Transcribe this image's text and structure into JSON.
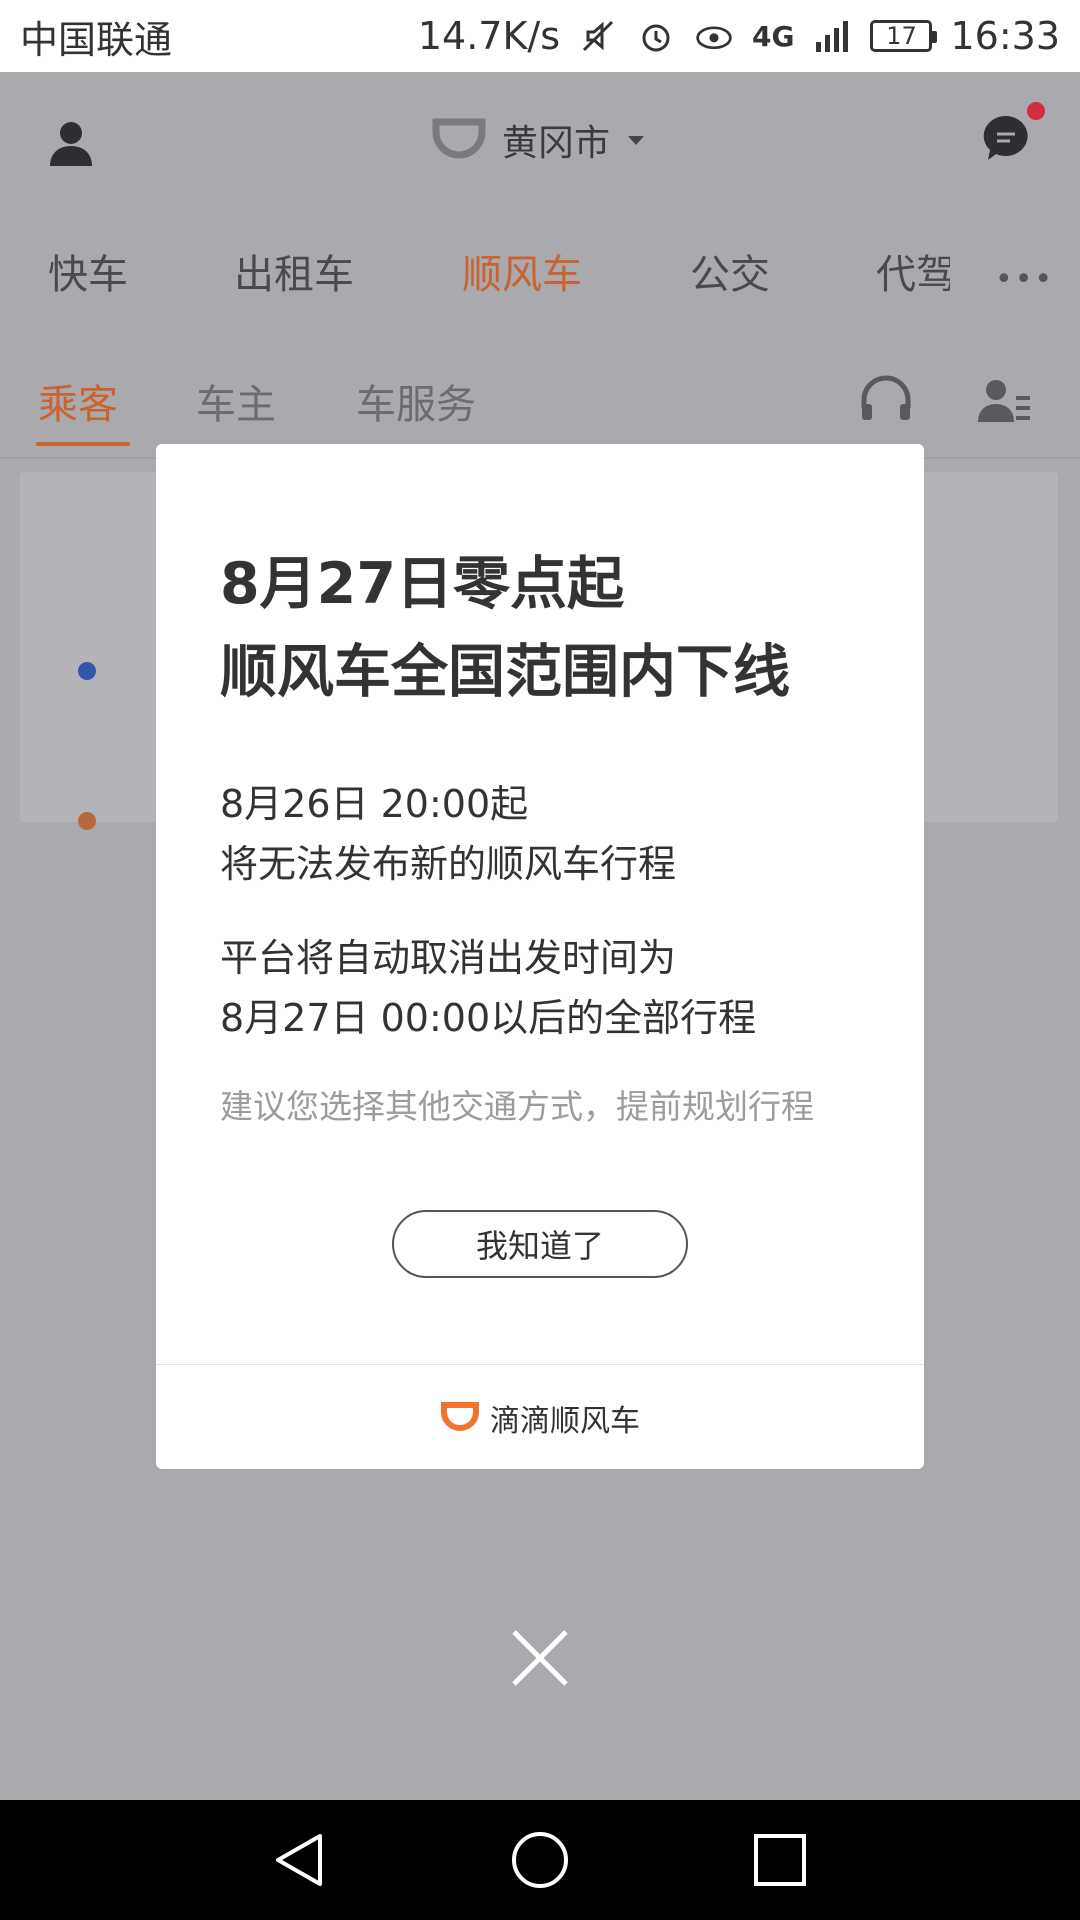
{
  "status_bar": {
    "carrier": "中国联通",
    "speed": "14.7K/s",
    "network": "4G",
    "battery": "17",
    "time": "16:33"
  },
  "header": {
    "city": "黄冈市"
  },
  "tabs": [
    {
      "label": "快车"
    },
    {
      "label": "出租车"
    },
    {
      "label": "顺风车",
      "active": true
    },
    {
      "label": "公交"
    },
    {
      "label": "代驾"
    }
  ],
  "subtabs": [
    {
      "label": "乘客",
      "active": true
    },
    {
      "label": "车主"
    },
    {
      "label": "车服务"
    }
  ],
  "modal": {
    "title_line1": "8月27日零点起",
    "title_line2": "顺风车全国范围内下线",
    "p1_line1": "8月26日 20:00起",
    "p1_line2": "将无法发布新的顺风车行程",
    "p2_line1": "平台将自动取消出发时间为",
    "p2_line2": "8月27日 00:00以后的全部行程",
    "hint": "建议您选择其他交通方式，提前规划行程",
    "ack_button": "我知道了",
    "brand": "滴滴顺风车"
  },
  "colors": {
    "accent": "#c9632f",
    "overlay_bg": "#a9a9ae",
    "brand_orange": "#f0742e",
    "notification": "#d12f3f"
  },
  "icons": {
    "avatar": "person-icon",
    "message": "chat-bubble-icon",
    "service": "headset-icon",
    "profile_list": "user-list-icon",
    "close": "close-icon",
    "nav_back": "triangle-back-icon",
    "nav_home": "circle-home-icon",
    "nav_recent": "square-recent-icon"
  }
}
